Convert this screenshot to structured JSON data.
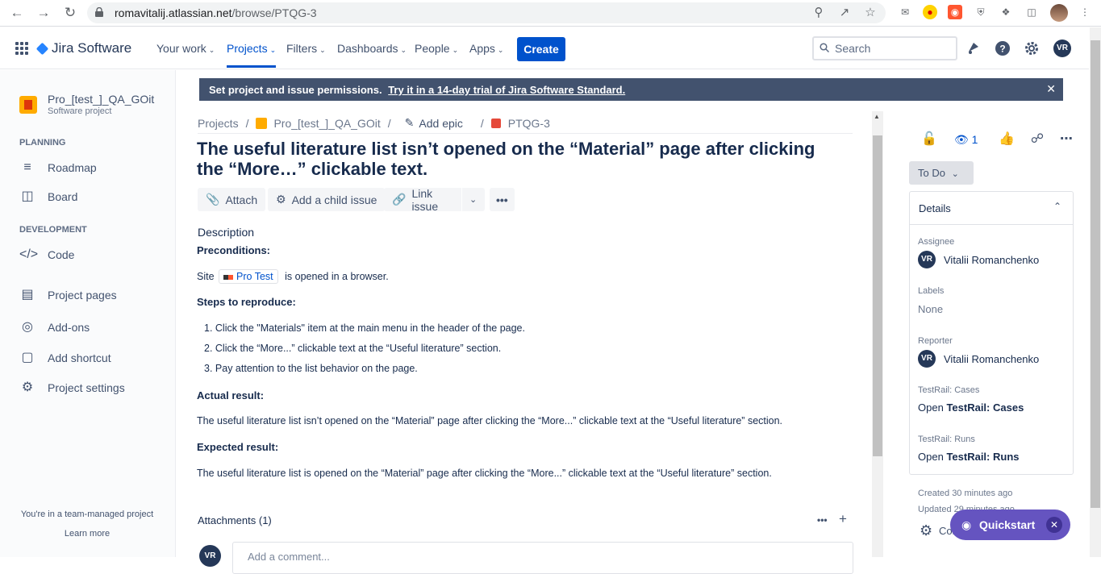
{
  "browser": {
    "url_host": "romavitalij.atlassian.net",
    "url_path": "/browse/PTQG-3"
  },
  "topnav": {
    "product": "Jira Software",
    "items": [
      "Your work",
      "Projects",
      "Filters",
      "Dashboards",
      "People",
      "Apps"
    ],
    "create": "Create",
    "search_placeholder": "Search",
    "user_initials": "VR"
  },
  "sidebar": {
    "project_name": "Pro_[test_]_QA_GOit",
    "project_type": "Software project",
    "planning_heading": "PLANNING",
    "roadmap": "Roadmap",
    "board": "Board",
    "development_heading": "DEVELOPMENT",
    "code": "Code",
    "project_pages": "Project pages",
    "addons": "Add-ons",
    "add_shortcut": "Add shortcut",
    "project_settings": "Project settings",
    "team_managed": "You're in a team-managed project",
    "learn_more": "Learn more"
  },
  "banner": {
    "text": "Set project and issue permissions.",
    "link": "Try it in a 14-day trial of Jira Software Standard."
  },
  "breadcrumb": {
    "projects": "Projects",
    "project": "Pro_[test_]_QA_GOit",
    "add_epic": "Add epic",
    "issue_key": "PTQG-3"
  },
  "issue": {
    "title": "The useful literature list isn’t opened on the “Material” page after clicking the “More…” clickable text.",
    "actions": {
      "attach": "Attach",
      "add_child": "Add a child issue",
      "link_issue": "Link issue"
    },
    "description_label": "Description",
    "preconditions_label": "Preconditions:",
    "site_prefix": "Site",
    "site_link": "Pro Test",
    "site_suffix": "is opened in a browser.",
    "steps_label": "Steps to reproduce:",
    "steps": [
      "Click the \"Materials\" item at the main menu in the header of the page.",
      "Click the “More...” clickable text at the “Useful literature” section.",
      "Pay attention to the list behavior on the page."
    ],
    "actual_label": "Actual result:",
    "actual_text": "The useful literature list isn’t opened on the “Material” page after clicking the “More...” clickable text at the “Useful literature” section.",
    "expected_label": "Expected result:",
    "expected_text": "The useful literature list is opened on the “Material” page after clicking the “More...” clickable text at the “Useful literature” section.",
    "attachments_label": "Attachments (1)",
    "comment_placeholder": "Add a comment..."
  },
  "right_panel": {
    "watch_count": "1",
    "status": "To Do",
    "details_title": "Details",
    "assignee_label": "Assignee",
    "assignee": "Vitalii Romanchenko",
    "labels_label": "Labels",
    "labels_value": "None",
    "reporter_label": "Reporter",
    "reporter": "Vitalii Romanchenko",
    "tr_cases_label": "TestRail: Cases",
    "tr_cases_open": "Open",
    "tr_cases_link": "TestRail: Cases",
    "tr_runs_label": "TestRail: Runs",
    "tr_runs_open": "Open",
    "tr_runs_link": "TestRail: Runs",
    "created": "Created 30 minutes ago",
    "updated": "Updated 29 minutes ago",
    "configure": "Configure"
  },
  "quickstart": {
    "label": "Quickstart"
  }
}
